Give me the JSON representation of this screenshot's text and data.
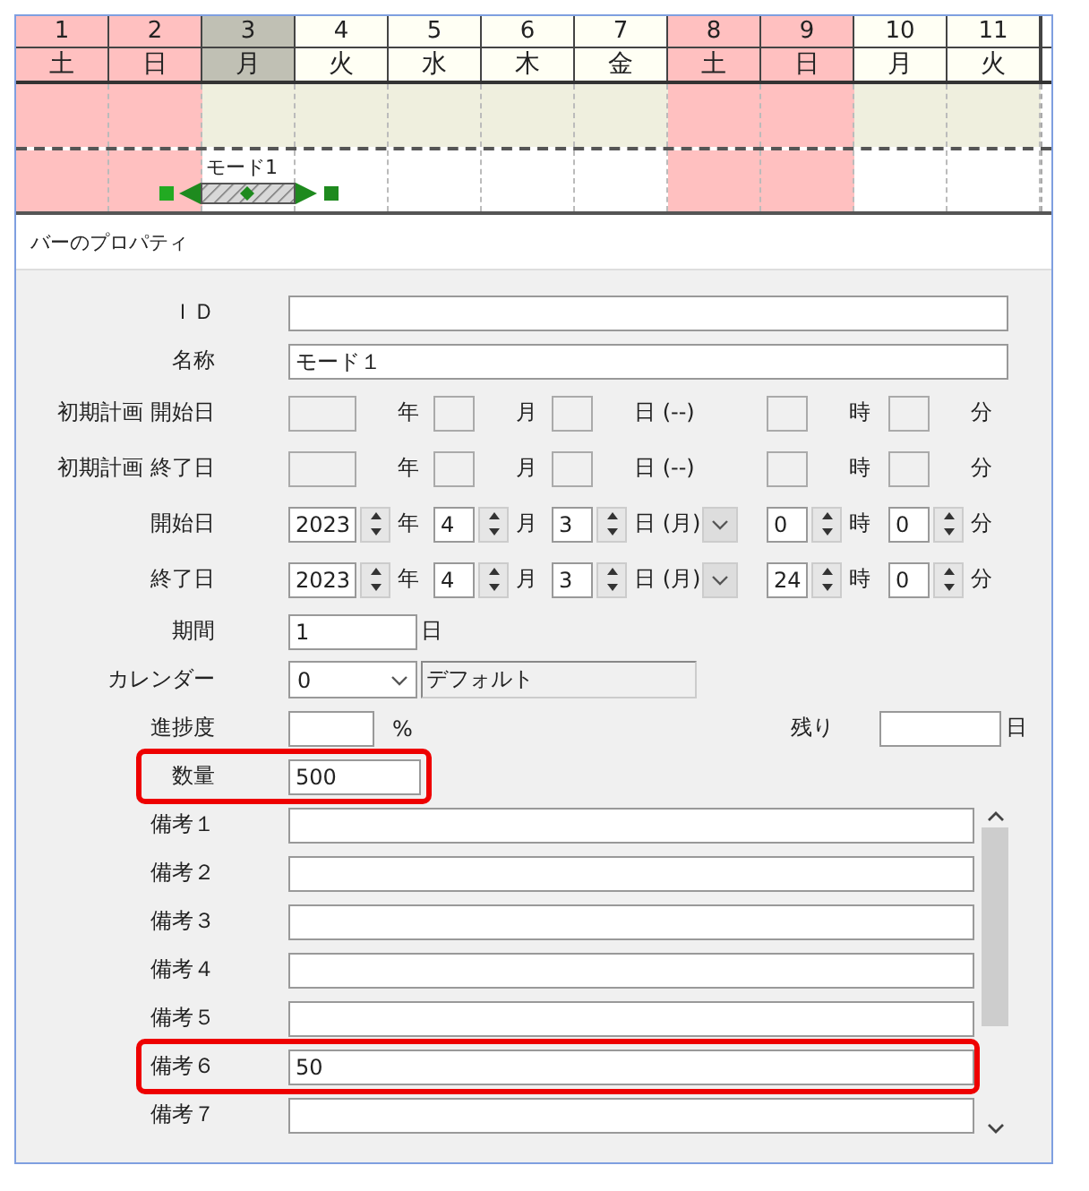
{
  "calendar": {
    "days": [
      {
        "number": "1",
        "weekday": "土",
        "kind": "weekend",
        "bar_start": false
      },
      {
        "number": "2",
        "weekday": "日",
        "kind": "weekend",
        "bar_start": false
      },
      {
        "number": "3",
        "weekday": "月",
        "kind": "current",
        "bar_start": true
      },
      {
        "number": "4",
        "weekday": "火",
        "kind": "weekday",
        "bar_start": false
      },
      {
        "number": "5",
        "weekday": "水",
        "kind": "weekday",
        "bar_start": false
      },
      {
        "number": "6",
        "weekday": "木",
        "kind": "weekday",
        "bar_start": false
      },
      {
        "number": "7",
        "weekday": "金",
        "kind": "weekday",
        "bar_start": false
      },
      {
        "number": "8",
        "weekday": "土",
        "kind": "weekend",
        "bar_start": false
      },
      {
        "number": "9",
        "weekday": "日",
        "kind": "weekend",
        "bar_start": false
      },
      {
        "number": "10",
        "weekday": "月",
        "kind": "weekday",
        "bar_start": false
      },
      {
        "number": "11",
        "weekday": "火",
        "kind": "weekday",
        "bar_start": false
      }
    ],
    "bar": {
      "label": "モード1"
    }
  },
  "panel": {
    "title": "バーのプロパティ",
    "fields": [
      {
        "kind": "text",
        "label": "ＩＤ",
        "highlighted": false
      },
      {
        "kind": "text",
        "label": "名称",
        "value": "モード１",
        "highlighted": false
      },
      {
        "kind": "date",
        "label": "初期計画 開始日",
        "disabled": true,
        "highlighted": false,
        "parts": [
          {
            "unit": "年"
          },
          {
            "unit": "月"
          },
          {
            "unit": "日 (--)"
          },
          {
            "unit": "時"
          },
          {
            "unit": "分"
          }
        ]
      },
      {
        "kind": "date",
        "label": "初期計画 終了日",
        "disabled": true,
        "highlighted": false,
        "parts": [
          {
            "unit": "年"
          },
          {
            "unit": "月"
          },
          {
            "unit": "日 (--)"
          },
          {
            "unit": "時"
          },
          {
            "unit": "分"
          }
        ]
      },
      {
        "kind": "date",
        "label": "開始日",
        "disabled": false,
        "highlighted": false,
        "parts": [
          {
            "value": "2023",
            "unit": "年"
          },
          {
            "value": "4",
            "unit": "月"
          },
          {
            "value": "3",
            "unit": "日 (月)"
          },
          {
            "value": "0",
            "unit": "時"
          },
          {
            "value": "0",
            "unit": "分"
          }
        ]
      },
      {
        "kind": "date",
        "label": "終了日",
        "disabled": false,
        "highlighted": false,
        "parts": [
          {
            "value": "2023",
            "unit": "年"
          },
          {
            "value": "4",
            "unit": "月"
          },
          {
            "value": "3",
            "unit": "日 (月)"
          },
          {
            "value": "24",
            "unit": "時"
          },
          {
            "value": "0",
            "unit": "分"
          }
        ]
      },
      {
        "kind": "duration",
        "label": "期間",
        "value": "1",
        "unit": "日",
        "highlighted": false
      },
      {
        "kind": "calendar",
        "label": "カレンダー",
        "value": "0",
        "name": "デフォルト",
        "highlighted": false
      },
      {
        "kind": "progress",
        "label": "進捗度",
        "unit": "%",
        "remaining_label": "残り",
        "remaining_unit": "日",
        "highlighted": false
      },
      {
        "kind": "quantity",
        "label": "数量",
        "value": "500",
        "highlighted": true
      }
    ],
    "notes": [
      {
        "label": "備考１",
        "highlighted": false
      },
      {
        "label": "備考２",
        "highlighted": false
      },
      {
        "label": "備考３",
        "highlighted": false
      },
      {
        "label": "備考４",
        "highlighted": false
      },
      {
        "label": "備考５",
        "highlighted": false
      },
      {
        "label": "備考６",
        "value": "50",
        "highlighted": true
      },
      {
        "label": "備考７",
        "highlighted": false
      }
    ]
  }
}
